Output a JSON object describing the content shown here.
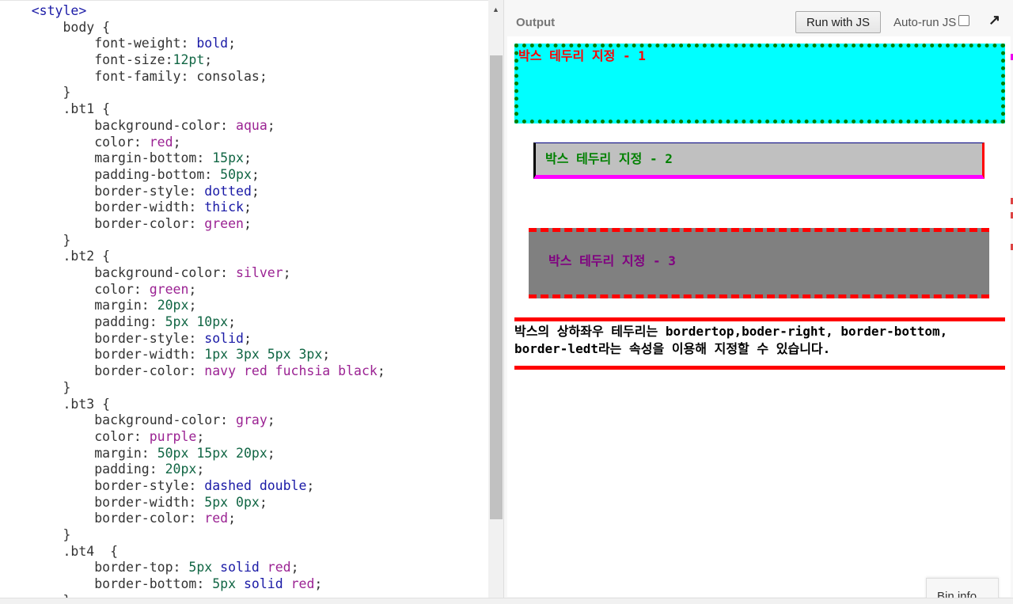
{
  "editor": {
    "lines": [
      [
        [
          "tag",
          "    <style>"
        ]
      ],
      [
        [
          "sel",
          "        body "
        ],
        [
          "sel",
          "{"
        ]
      ],
      [
        [
          "prop",
          "            font-weight: "
        ],
        [
          "kw",
          "bold"
        ],
        [
          "prop",
          ";"
        ]
      ],
      [
        [
          "prop",
          "            font-size:"
        ],
        [
          "num",
          "12pt"
        ],
        [
          "prop",
          ";"
        ]
      ],
      [
        [
          "prop",
          "            font-family: "
        ],
        [
          "prop",
          "consolas"
        ],
        [
          "prop",
          ";"
        ]
      ],
      [
        [
          "sel",
          "        }"
        ]
      ],
      [
        [
          "sel",
          "        .bt1 {"
        ]
      ],
      [
        [
          "prop",
          "            background-color: "
        ],
        [
          "str",
          "aqua"
        ],
        [
          "prop",
          ";"
        ]
      ],
      [
        [
          "prop",
          "            color: "
        ],
        [
          "str",
          "red"
        ],
        [
          "prop",
          ";"
        ]
      ],
      [
        [
          "prop",
          "            margin-bottom: "
        ],
        [
          "num",
          "15px"
        ],
        [
          "prop",
          ";"
        ]
      ],
      [
        [
          "prop",
          "            padding-bottom: "
        ],
        [
          "num",
          "50px"
        ],
        [
          "prop",
          ";"
        ]
      ],
      [
        [
          "prop",
          "            border-style: "
        ],
        [
          "kw",
          "dotted"
        ],
        [
          "prop",
          ";"
        ]
      ],
      [
        [
          "prop",
          "            border-width: "
        ],
        [
          "kw",
          "thick"
        ],
        [
          "prop",
          ";"
        ]
      ],
      [
        [
          "prop",
          "            border-color: "
        ],
        [
          "str",
          "green"
        ],
        [
          "prop",
          ";"
        ]
      ],
      [
        [
          "sel",
          "        }"
        ]
      ],
      [
        [
          "sel",
          "        .bt2 {"
        ]
      ],
      [
        [
          "prop",
          "            background-color: "
        ],
        [
          "str",
          "silver"
        ],
        [
          "prop",
          ";"
        ]
      ],
      [
        [
          "prop",
          "            color: "
        ],
        [
          "str",
          "green"
        ],
        [
          "prop",
          ";"
        ]
      ],
      [
        [
          "prop",
          "            margin: "
        ],
        [
          "num",
          "20px"
        ],
        [
          "prop",
          ";"
        ]
      ],
      [
        [
          "prop",
          "            padding: "
        ],
        [
          "num",
          "5px 10px"
        ],
        [
          "prop",
          ";"
        ]
      ],
      [
        [
          "prop",
          "            border-style: "
        ],
        [
          "kw",
          "solid"
        ],
        [
          "prop",
          ";"
        ]
      ],
      [
        [
          "prop",
          "            border-width: "
        ],
        [
          "num",
          "1px 3px 5px 3px"
        ],
        [
          "prop",
          ";"
        ]
      ],
      [
        [
          "prop",
          "            border-color: "
        ],
        [
          "str",
          "navy red fuchsia black"
        ],
        [
          "prop",
          ";"
        ]
      ],
      [
        [
          "sel",
          "        }"
        ]
      ],
      [
        [
          "sel",
          "        .bt3 {"
        ]
      ],
      [
        [
          "prop",
          "            background-color: "
        ],
        [
          "str",
          "gray"
        ],
        [
          "prop",
          ";"
        ]
      ],
      [
        [
          "prop",
          "            color: "
        ],
        [
          "str",
          "purple"
        ],
        [
          "prop",
          ";"
        ]
      ],
      [
        [
          "prop",
          "            margin: "
        ],
        [
          "num",
          "50px 15px 20px"
        ],
        [
          "prop",
          ";"
        ]
      ],
      [
        [
          "prop",
          "            padding: "
        ],
        [
          "num",
          "20px"
        ],
        [
          "prop",
          ";"
        ]
      ],
      [
        [
          "prop",
          "            border-style: "
        ],
        [
          "kw",
          "dashed double"
        ],
        [
          "prop",
          ";"
        ]
      ],
      [
        [
          "prop",
          "            border-width: "
        ],
        [
          "num",
          "5px 0px"
        ],
        [
          "prop",
          ";"
        ]
      ],
      [
        [
          "prop",
          "            border-color: "
        ],
        [
          "str",
          "red"
        ],
        [
          "prop",
          ";"
        ]
      ],
      [
        [
          "sel",
          "        }"
        ]
      ],
      [
        [
          "sel",
          "        .bt4  {"
        ]
      ],
      [
        [
          "prop",
          "            border-top: "
        ],
        [
          "num",
          "5px"
        ],
        [
          "kw",
          " solid "
        ],
        [
          "str",
          "red"
        ],
        [
          "prop",
          ";"
        ]
      ],
      [
        [
          "prop",
          "            border-bottom: "
        ],
        [
          "num",
          "5px"
        ],
        [
          "kw",
          " solid "
        ],
        [
          "str",
          "red"
        ],
        [
          "prop",
          ";"
        ]
      ],
      [
        [
          "sel",
          "        }"
        ]
      ]
    ]
  },
  "output": {
    "label": "Output",
    "run_button": "Run with JS",
    "autorun_label": "Auto-run JS",
    "autorun_checked": false,
    "expand_icon": "↗",
    "boxes": {
      "bt1": "박스 테두리 지정 - 1",
      "bt2": "박스 테두리 지정 - 2",
      "bt3": "박스 테두리 지정 - 3",
      "bt4": "박스의 상하좌우 테두리는 bordertop,boder-right, border-bottom, border-ledt라는 속성을 이용해 지정할 수 있습니다."
    }
  },
  "bin_info_label": "Bin info",
  "colors": {
    "tag": "#1a1aa6",
    "keyword": "#1a1aa6",
    "string": "#9b2393",
    "number": "#116644"
  }
}
